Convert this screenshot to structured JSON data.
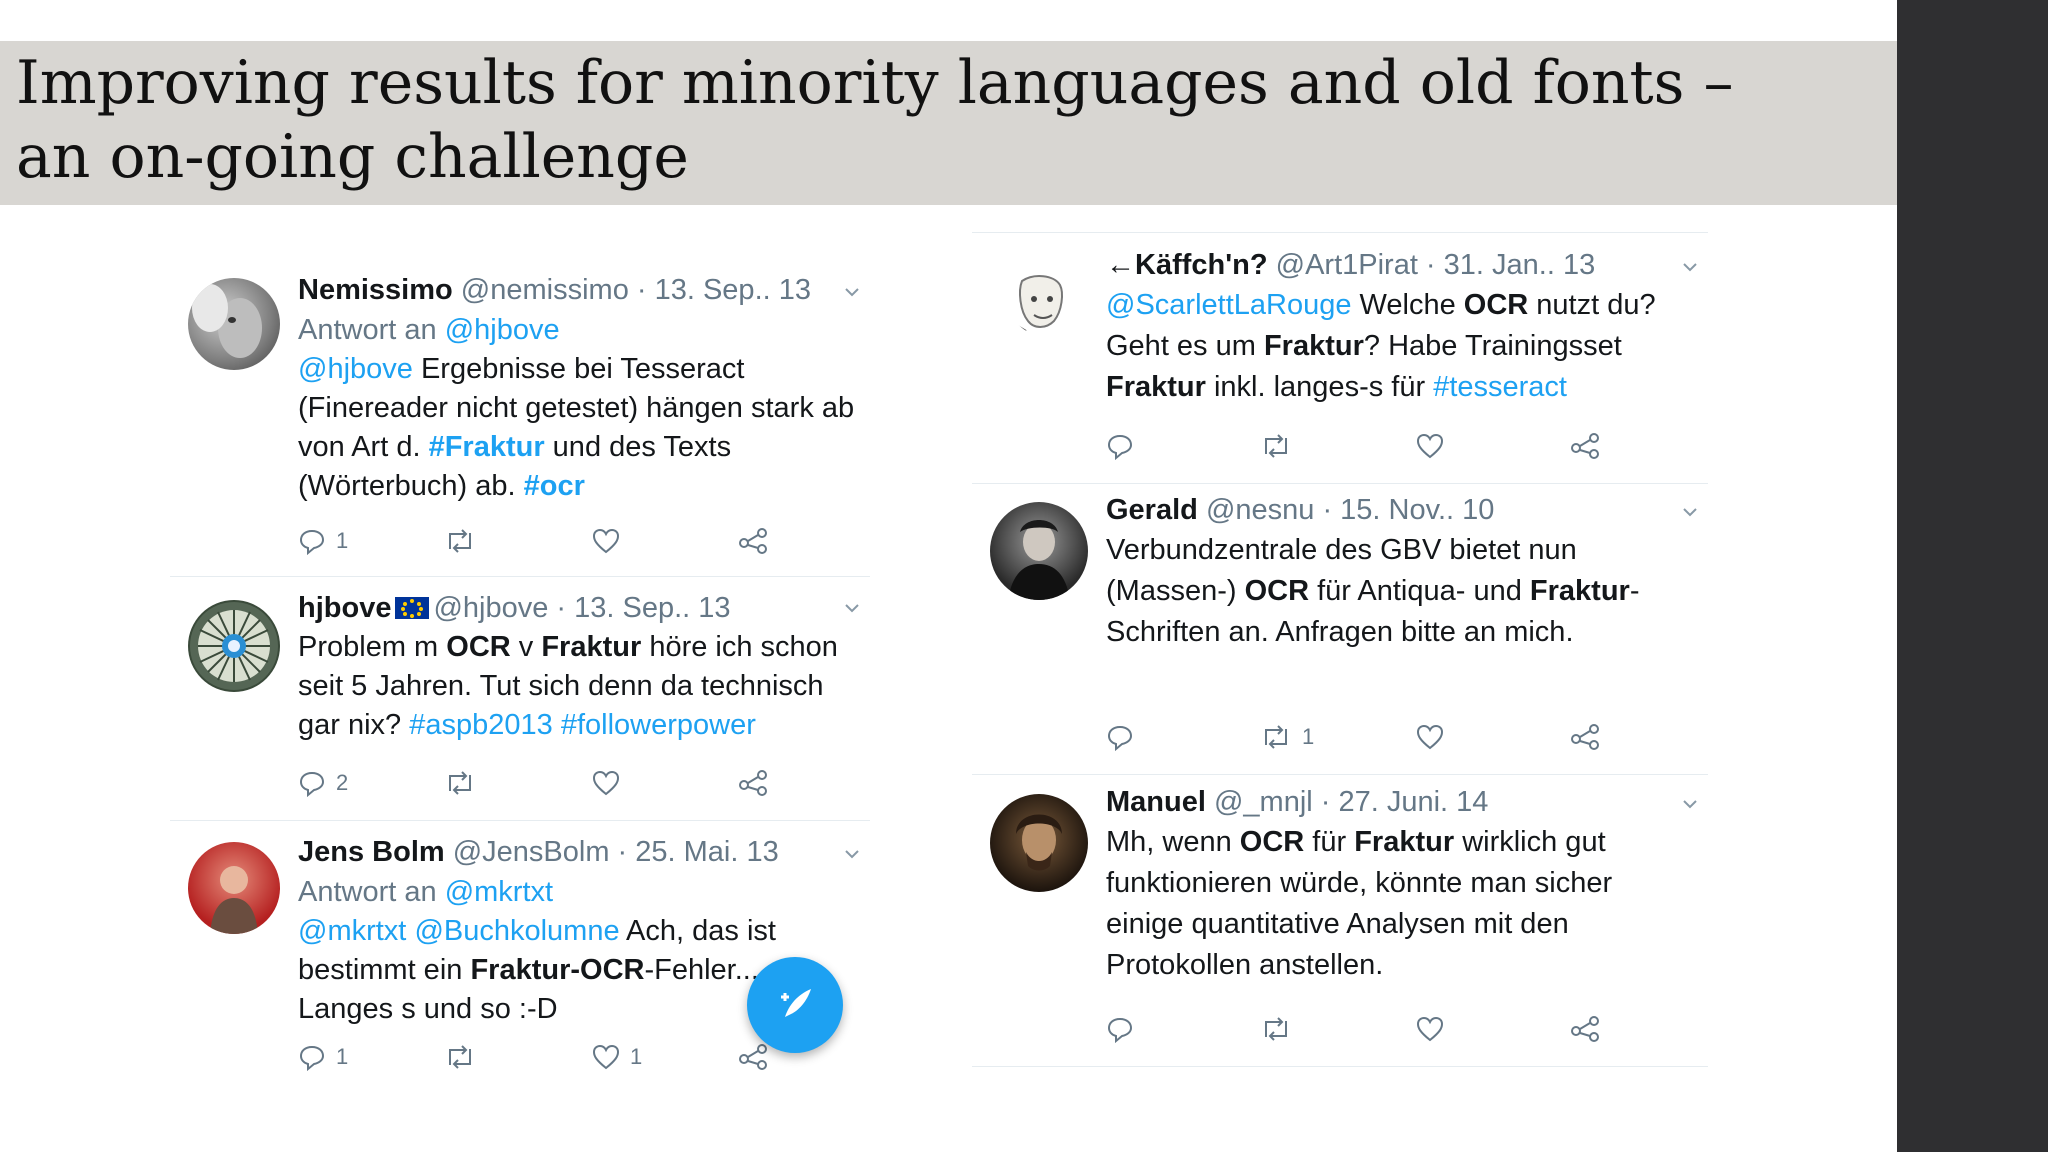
{
  "slide": {
    "title": "Improving results for minority languages and old fonts –\nan on-going challenge"
  },
  "colors": {
    "link": "#1da1f2",
    "text": "#14171a",
    "muted": "#657786",
    "title_bar": "#d8d6d2",
    "dark_side": "#2f2f31"
  },
  "tweets_left": [
    {
      "name": "Nemissimo",
      "meta": "@nemissimo · 13. Sep.. 13",
      "reply_prefix": "Antwort an ",
      "reply_handle": "@hjbove",
      "text": {
        "a": "@hjbove",
        "b": " Ergebnisse bei Tesseract (Finereader nicht getestet) hängen stark ab von Art d. ",
        "c": "#Fraktur",
        "d": " und des Texts (Wörterbuch) ab. ",
        "e": "#ocr"
      },
      "reply_count": "1",
      "retweet_count": "",
      "like_count": ""
    },
    {
      "name": "hjbove",
      "meta": "@hjbove · 13. Sep.. 13",
      "text": {
        "a": "Problem m ",
        "b": "OCR",
        "c": " v ",
        "d": "Fraktur",
        "e": " höre ich schon seit 5 Jahren. Tut sich denn da technisch gar nix? ",
        "f": "#aspb2013",
        "g": " ",
        "h": "#followerpower"
      },
      "reply_count": "2",
      "retweet_count": "",
      "like_count": ""
    },
    {
      "name": "Jens Bolm",
      "meta": "@JensBolm · 25. Mai. 13",
      "reply_prefix": "Antwort an ",
      "reply_handle": "@mkrtxt",
      "text": {
        "a": "@mkrtxt",
        "b": " ",
        "c": "@Buchkolumne",
        "d": " Ach, das ist bestimmt ein ",
        "e": "Fraktur-OCR",
        "f": "-Fehler...",
        "g": "Langes s und so :-D"
      },
      "reply_count": "1",
      "retweet_count": "",
      "like_count": "1"
    }
  ],
  "tweets_right": [
    {
      "name": "←Käffch'n?",
      "meta": "@Art1Pirat · 31. Jan.. 13",
      "text": {
        "a": "@ScarlettLaRouge",
        "b": " Welche ",
        "c": "OCR",
        "d": " nutzt du? Geht es um ",
        "e": "Fraktur",
        "f": "? Habe Trainingsset ",
        "g": "Fraktur",
        "h": " inkl.  langes-s für ",
        "i": "#tesseract"
      },
      "reply_count": "",
      "retweet_count": "",
      "like_count": ""
    },
    {
      "name": "Gerald",
      "meta": "@nesnu · 15. Nov.. 10",
      "text": {
        "a": "Verbundzentrale des GBV bietet nun (Massen-) ",
        "b": "OCR",
        "c": " für Antiqua- und ",
        "d": "Fraktur",
        "e": "-Schriften an. Anfragen bitte an mich."
      },
      "reply_count": "",
      "retweet_count": "1",
      "like_count": ""
    },
    {
      "name": "Manuel",
      "meta": "@_mnjl · 27. Juni. 14",
      "text": {
        "a": "Mh, wenn ",
        "b": "OCR",
        "c": " für ",
        "d": "Fraktur",
        "e": " wirklich gut funktionieren würde, könnte man sicher einige quantitative Analysen mit den Protokollen anstellen."
      },
      "reply_count": "",
      "retweet_count": "",
      "like_count": ""
    }
  ],
  "icons": {
    "reply": "speech-bubble-icon",
    "retweet": "retweet-icon",
    "like": "heart-icon",
    "share": "share-icon",
    "more": "chevron-down-icon",
    "compose": "compose-tweet-icon"
  }
}
